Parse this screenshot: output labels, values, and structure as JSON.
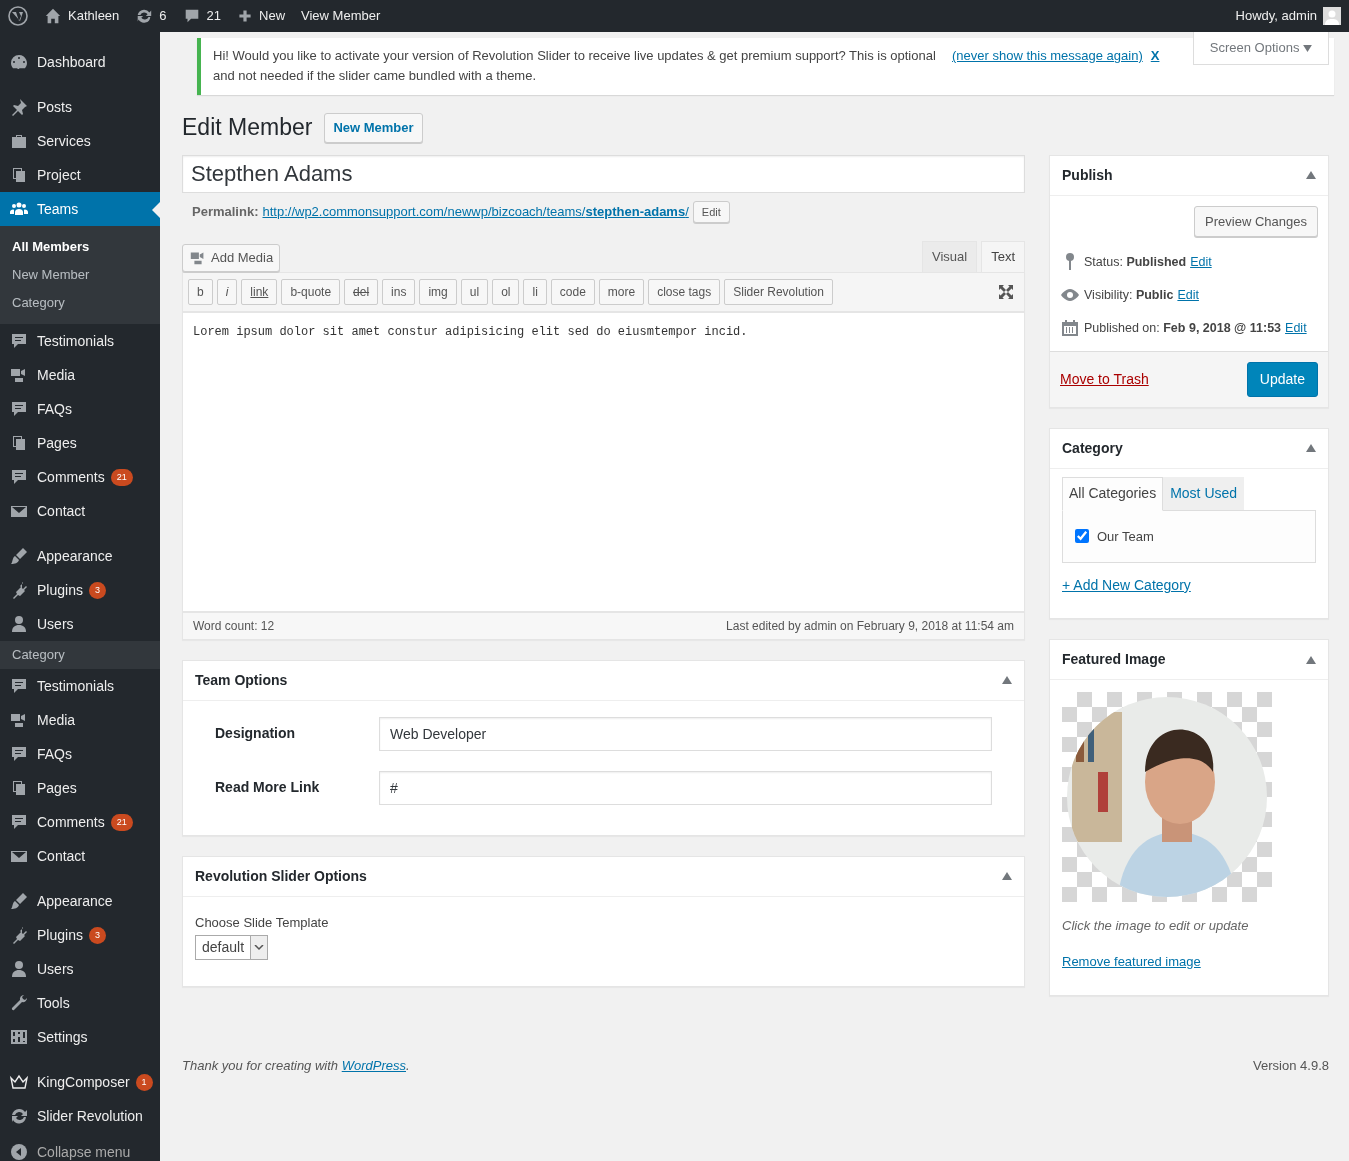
{
  "admin_bar": {
    "site": "Kathleen",
    "updates": "6",
    "comments": "21",
    "new": "New",
    "view": "View Member",
    "account": "Howdy, admin"
  },
  "sidebar": {
    "groups": [
      [
        {
          "label": "Dashboard",
          "current": false
        }
      ],
      [
        {
          "label": "Posts",
          "current": false
        },
        {
          "label": "Services",
          "current": false
        },
        {
          "label": "Project",
          "current": false
        },
        {
          "label": "Teams",
          "current": true,
          "children": [
            {
              "label": "All Members",
              "selected": true
            },
            {
              "label": "New Member",
              "selected": false
            },
            {
              "label": "Category",
              "selected": false
            }
          ]
        },
        {
          "label": "Testimonials",
          "current": false
        },
        {
          "label": "Media",
          "current": false
        },
        {
          "label": "FAQs",
          "current": false
        },
        {
          "label": "Pages",
          "current": false
        },
        {
          "label": "Comments",
          "current": false,
          "badge": "21"
        },
        {
          "label": "Contact",
          "current": false
        }
      ],
      [
        {
          "label": "Appearance",
          "current": false
        },
        {
          "label": "Plugins",
          "current": false,
          "badge": "3"
        },
        {
          "label": "Users",
          "current": false,
          "children": [
            {
              "label": "Category",
              "selected": false
            }
          ]
        },
        {
          "label": "Testimonials",
          "current": false
        },
        {
          "label": "Media",
          "current": false
        },
        {
          "label": "FAQs",
          "current": false
        },
        {
          "label": "Pages",
          "current": false
        },
        {
          "label": "Comments",
          "current": false,
          "badge": "21"
        },
        {
          "label": "Contact",
          "current": false
        }
      ],
      [
        {
          "label": "Appearance",
          "current": false
        },
        {
          "label": "Plugins",
          "current": false,
          "badge": "3"
        },
        {
          "label": "Users",
          "current": false
        },
        {
          "label": "Tools",
          "current": false
        },
        {
          "label": "Settings",
          "current": false
        }
      ],
      [
        {
          "label": "KingComposer",
          "current": false,
          "badge": "1"
        },
        {
          "label": "Slider Revolution",
          "current": false
        }
      ]
    ],
    "collapse": "Collapse menu"
  },
  "notice": {
    "text": "Hi! Would you like to activate your version of Revolution Slider to receive live updates & get premium support? This is optional and not needed if the slider came bundled with a theme.",
    "link": "(never show this message again)",
    "dismiss": "X"
  },
  "screen_options": "Screen Options",
  "page": {
    "title": "Edit Member",
    "add_new": "New Member"
  },
  "post_title": "Stepthen Adams",
  "permalink": {
    "label": "Permalink:",
    "url": "http://wp2.commonsupport.com/newwp/bizcoach/teams/**stepthen-adams**/",
    "edit": "Edit"
  },
  "editor": {
    "add_media": "Add Media",
    "tabs": [
      {
        "label": "Visual",
        "selected": false
      },
      {
        "label": "Text",
        "selected": true
      }
    ],
    "quicktags": [
      {
        "label": "b",
        "kind": "plain"
      },
      {
        "label": "i",
        "kind": "italic"
      },
      {
        "label": "link",
        "kind": "underline"
      },
      {
        "label": "b-quote",
        "kind": "plain"
      },
      {
        "label": "del",
        "kind": "strike"
      },
      {
        "label": "ins",
        "kind": "plain"
      },
      {
        "label": "img",
        "kind": "plain"
      },
      {
        "label": "ul",
        "kind": "plain"
      },
      {
        "label": "ol",
        "kind": "plain"
      },
      {
        "label": "li",
        "kind": "plain"
      },
      {
        "label": "code",
        "kind": "plain"
      },
      {
        "label": "more",
        "kind": "plain"
      },
      {
        "label": "close tags",
        "kind": "plain"
      },
      {
        "label": "Slider Revolution",
        "kind": "plain"
      }
    ],
    "content": "Lorem ipsum dolor sit amet constur adipisicing elit sed do eiusmtempor incid.",
    "word_count": "Word count: 12",
    "last_edited": "Last edited by admin on February 9, 2018 at 11:54 am"
  },
  "team_options": {
    "title": "Team Options",
    "fields": [
      {
        "label": "Designation",
        "value": "Web Developer"
      },
      {
        "label": "Read More Link",
        "value": "#"
      }
    ]
  },
  "slider_options": {
    "title": "Revolution Slider Options",
    "label": "Choose Slide Template",
    "value": "default"
  },
  "publish": {
    "title": "Publish",
    "preview": "Preview Changes",
    "rows": [
      {
        "label": "Status: ",
        "value": "Published",
        "edit": "Edit"
      },
      {
        "label": "Visibility: ",
        "value": "Public",
        "edit": "Edit"
      },
      {
        "label": "Published on: ",
        "value": "Feb 9, 2018 @ 11:53",
        "edit": "Edit"
      }
    ],
    "trash": "Move to Trash",
    "update": "Update"
  },
  "category": {
    "title": "Category",
    "tabs": [
      {
        "label": "All Categories",
        "selected": true
      },
      {
        "label": "Most Used",
        "selected": false
      }
    ],
    "items": [
      {
        "label": "Our Team",
        "checked": true
      }
    ],
    "add": "+ Add New Category"
  },
  "featured_image": {
    "title": "Featured Image",
    "kind": "picture",
    "hint": "Click the image to edit or update",
    "remove": "Remove featured image"
  },
  "footer": {
    "text": "Thank you for creating with ",
    "link": "WordPress",
    "end": ".",
    "version": "Version 4.9.8"
  }
}
